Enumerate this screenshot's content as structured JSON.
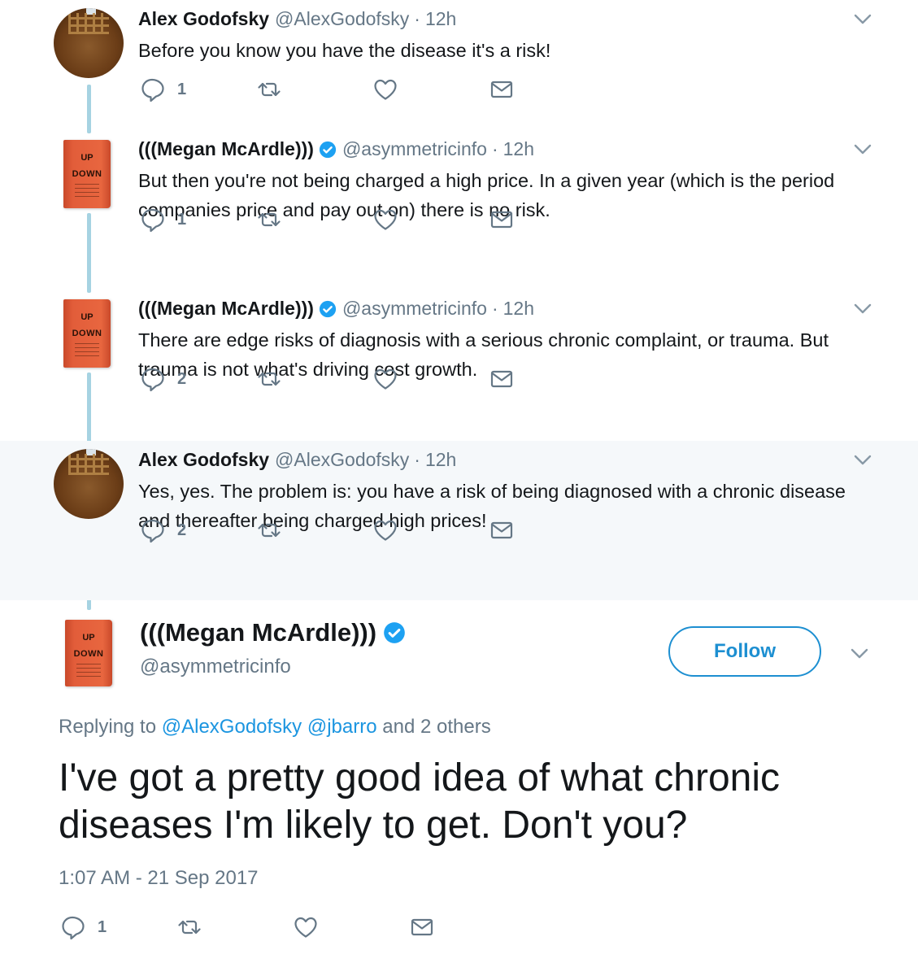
{
  "colors": {
    "accent": "#1d8fd1",
    "link": "#1b95e0",
    "muted": "#657786",
    "thread_line": "#a6d3e2",
    "highlight_bg": "#f5f8fa"
  },
  "icons": {
    "reply": "reply-icon",
    "retweet": "retweet-icon",
    "like": "heart-icon",
    "dm": "envelope-icon",
    "more": "chevron-down-icon",
    "verified": "verified-badge-icon"
  },
  "thread": [
    {
      "avatar": "waffle",
      "name": "Alex Godofsky",
      "verified": false,
      "handle": "@AlexGodofsky",
      "time": "12h",
      "text": "Before you know you have the disease it's a risk!",
      "reply_count": "1",
      "highlight": false
    },
    {
      "avatar": "book",
      "name": "(((Megan McArdle)))",
      "verified": true,
      "handle": "@asymmetricinfo",
      "time": "12h",
      "text": "But then you're not being charged a high price. In a given year (which is the period companies price and pay out on) there is no risk.",
      "reply_count": "1",
      "highlight": false
    },
    {
      "avatar": "book",
      "name": "(((Megan McArdle)))",
      "verified": true,
      "handle": "@asymmetricinfo",
      "time": "12h",
      "text": "There are edge risks of diagnosis with a serious chronic complaint, or trauma. But trauma is not what's driving cost growth.",
      "reply_count": "2",
      "highlight": false
    },
    {
      "avatar": "waffle",
      "name": "Alex Godofsky",
      "verified": false,
      "handle": "@AlexGodofsky",
      "time": "12h",
      "text": "Yes, yes. The problem is: you have a risk of being diagnosed with a chronic disease and thereafter being charged high prices!",
      "reply_count": "2",
      "highlight": true
    }
  ],
  "book_cover": {
    "title_top": "UP",
    "title_bottom": "DOWN"
  },
  "main_tweet": {
    "name": "(((Megan McArdle)))",
    "handle": "@asymmetricinfo",
    "follow_label": "Follow",
    "replying_prefix": "Replying to",
    "replying_user1": "@AlexGodofsky",
    "replying_user2": "@jbarro",
    "replying_suffix": "and 2 others",
    "text": "I've got a pretty good idea of what chronic diseases I'm likely to get. Don't you?",
    "timestamp": "1:07 AM - 21 Sep 2017",
    "reply_count": "1"
  }
}
